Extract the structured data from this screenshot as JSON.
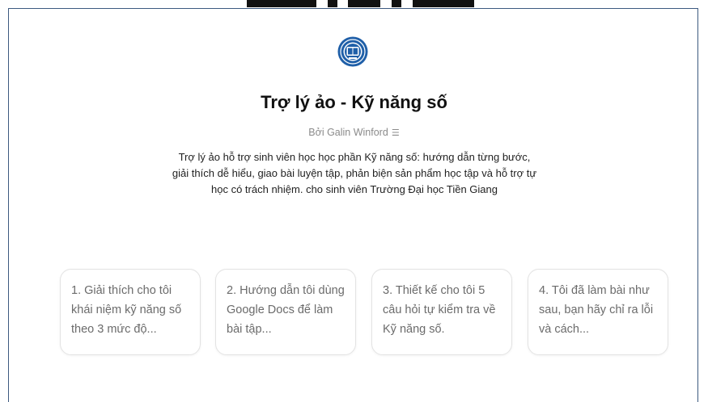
{
  "header": {
    "logo_icon": "university-seal-icon",
    "title": "Trợ lý ảo - Kỹ năng số",
    "byline": "Bởi Galin Winford",
    "byline_icon": "person-icon",
    "description": "Trợ lý ảo hỗ trợ sinh viên học học phần Kỹ năng số: hướng dẫn từng bước, giải thích dễ hiểu, giao bài luyện tập, phản biện sản phẩm học tập và hỗ trợ tự học có trách nhiệm. cho sinh viên Trường Đại học Tiền Giang"
  },
  "starters": [
    {
      "text": "1. Giải thích cho tôi khái niệm kỹ năng số theo 3 mức độ..."
    },
    {
      "text": "2. Hướng dẫn tôi dùng Google Docs để làm bài tập..."
    },
    {
      "text": "3. Thiết kế cho tôi 5 câu hỏi tự kiểm tra về Kỹ năng số."
    },
    {
      "text": "4. Tôi đã làm bài như sau, bạn hãy chỉ ra lỗi và cách..."
    }
  ],
  "colors": {
    "logo_blue": "#1f5fa8",
    "card_border": "#e3e3e3",
    "frame_border": "#3d5a80"
  }
}
